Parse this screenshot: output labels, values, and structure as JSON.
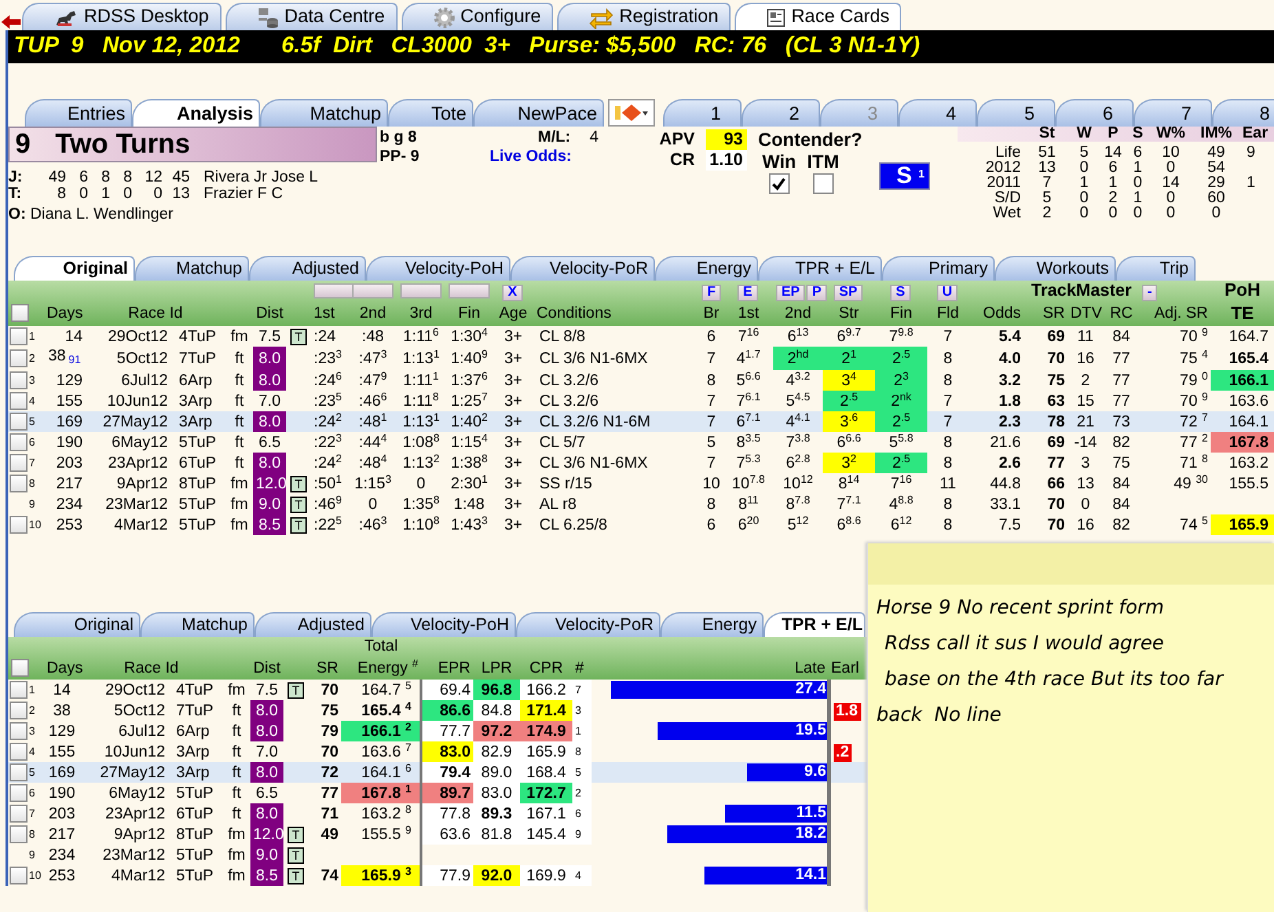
{
  "top_tabs": [
    {
      "label": "RDSS Desktop",
      "selected": false
    },
    {
      "label": "Data Centre",
      "selected": false
    },
    {
      "label": "Configure",
      "selected": false
    },
    {
      "label": "Registration",
      "selected": false
    },
    {
      "label": "Race Cards",
      "selected": true
    }
  ],
  "race_header": {
    "left": "TUP  9   Nov 12, 2012",
    "right": "6.5f  Dirt   CL3000  3+   Purse: $5,500   RC: 76   (CL 3 N1-1Y)"
  },
  "section_tabs": [
    {
      "label": "Entries",
      "selected": false
    },
    {
      "label": "Analysis",
      "selected": true
    },
    {
      "label": "Matchup",
      "selected": false
    },
    {
      "label": "Tote",
      "selected": false
    },
    {
      "label": "NewPace",
      "selected": false
    }
  ],
  "horse_tabs": [
    {
      "label": "1",
      "disabled": false
    },
    {
      "label": "2",
      "disabled": false
    },
    {
      "label": "3",
      "disabled": true
    },
    {
      "label": "4",
      "disabled": false
    },
    {
      "label": "5",
      "disabled": false
    },
    {
      "label": "6",
      "disabled": false
    },
    {
      "label": "7",
      "disabled": false
    },
    {
      "label": "8",
      "disabled": false
    }
  ],
  "horse": {
    "number": "9",
    "name": "Two Turns",
    "description": "b g 8",
    "post": "PP- 9",
    "ml_label": "M/L:",
    "ml_value": "4",
    "live_odds_label": "Live Odds:",
    "connections": [
      {
        "label": "J:",
        "stats": [
          "49",
          "6",
          "8",
          "8",
          "12",
          "45"
        ],
        "name": "Rivera Jr Jose L"
      },
      {
        "label": "T:",
        "stats": [
          "8",
          "0",
          "1",
          "0",
          "0",
          "13"
        ],
        "name": "Frazier F C"
      }
    ],
    "owner_label": "O:",
    "owner": "Diana L. Wendlinger",
    "apv_label": "APV",
    "apv": "93",
    "cr_label": "CR",
    "cr": "1.10",
    "contender": {
      "title": "Contender?",
      "options": [
        {
          "label": "Win",
          "checked": true
        },
        {
          "label": "ITM",
          "checked": false
        }
      ]
    },
    "speed_button": "S $^{1}$",
    "record": {
      "columns": [
        "St",
        "W",
        "P",
        "S",
        "W%",
        "IM%",
        "Ear"
      ],
      "rows": [
        {
          "label": "Life",
          "values": [
            "51",
            "5",
            "14",
            "6",
            "10",
            "49",
            "9"
          ]
        },
        {
          "label": "2012",
          "values": [
            "13",
            "0",
            "6",
            "1",
            "0",
            "54"
          ]
        },
        {
          "label": "2011",
          "values": [
            "7",
            "1",
            "1",
            "0",
            "14",
            "29",
            "1"
          ]
        },
        {
          "label": "S/D",
          "values": [
            "5",
            "0",
            "2",
            "1",
            "0",
            "60"
          ]
        },
        {
          "label": "Wet",
          "values": [
            "2",
            "0",
            "0",
            "0",
            "0",
            "0"
          ]
        }
      ]
    }
  },
  "upper_tabs": [
    {
      "label": "Original",
      "selected": true
    },
    {
      "label": "Matchup",
      "selected": false
    },
    {
      "label": "Adjusted",
      "selected": false
    },
    {
      "label": "Velocity-PoH",
      "selected": false
    },
    {
      "label": "Velocity-PoR",
      "selected": false
    },
    {
      "label": "Energy",
      "selected": false
    },
    {
      "label": "TPR + E/L",
      "selected": false
    },
    {
      "label": "Primary",
      "selected": false
    },
    {
      "label": "Workouts",
      "selected": false
    },
    {
      "label": "Trip",
      "selected": false
    }
  ],
  "upper_table": {
    "select_all_checked": false,
    "clear_button": "X",
    "pace_buttons": [
      "F",
      "E",
      "EP",
      "P",
      "SP",
      "S",
      "U"
    ],
    "trackmaster_label": "TrackMaster",
    "collapse_button": "-",
    "poh_label": "PoH",
    "columns": [
      "Days",
      "Race Id",
      "Dist",
      "1st",
      "2nd",
      "3rd",
      "Fin",
      "Age",
      "Conditions",
      "Br",
      "1st",
      "2nd",
      "Str",
      "Fin",
      "Fld",
      "Odds",
      "SR",
      "DTV",
      "RC",
      "Adj. SR",
      "TE"
    ],
    "rows": [
      {
        "n": "1",
        "checked": false,
        "selected": false,
        "days": "14",
        "date": "29Oct12",
        "race": "4TuP",
        "surf": "fm",
        "dist": "7.5",
        "turf": "T",
        "c1": ":24",
        "c2": ":48",
        "c3": "1:11$^{6}$",
        "fin": "1:30$^{4}$",
        "age": "3+",
        "cond": "CL 8/8",
        "br": "6",
        "p1": "7$^{16}$",
        "p2": "6$^{13}$",
        "str": "6$^{9.7}$",
        "pfin": "7$^{9.8}$",
        "fld": "7",
        "odds": {
          "text": "5.4",
          "bold": true
        },
        "sr": "69",
        "dtv": "11",
        "rc": "84",
        "adj": "70 $^{9}$",
        "te": "164.7"
      },
      {
        "n": "2",
        "checked": false,
        "selected": false,
        "days": "38",
        "days_note": "91",
        "date": "5Oct12",
        "race": "7TuP",
        "surf": "ft",
        "dist": {
          "text": "8.0",
          "color": "#800080"
        },
        "c1": ":23$^{3}$",
        "c2": ":47$^{3}$",
        "c3": "1:13$^{1}$",
        "fin": "1:40$^{9}$",
        "age": "3+",
        "cond": "CL 3/6 N1-6MX",
        "br": "7",
        "p1": "4$^{1.7}$",
        "p2": {
          "text": "2$^{hd}$",
          "color": "#2de680"
        },
        "str": {
          "text": "2$^{1}$",
          "color": "#2de680"
        },
        "pfin": {
          "text": "2$^{.5}$",
          "color": "#2de680"
        },
        "fld": "8",
        "odds": {
          "text": "4.0",
          "bold": true
        },
        "sr": "70",
        "dtv": "16",
        "rc": "77",
        "adj": "75 $^{4}$",
        "te": {
          "text": "165.4",
          "bold": true
        }
      },
      {
        "n": "3",
        "checked": false,
        "selected": false,
        "days": "129",
        "date": "6Jul12",
        "race": "6Arp",
        "surf": "ft",
        "dist": {
          "text": "8.0",
          "color": "#800080"
        },
        "c1": ":24$^{6}$",
        "c2": ":47$^{9}$",
        "c3": "1:11$^{1}$",
        "fin": "1:37$^{6}$",
        "age": "3+",
        "cond": "CL 3.2/6",
        "br": "8",
        "p1": "5$^{6.6}$",
        "p2": "4$^{3.2}$",
        "str": {
          "text": "3$^{4}$",
          "color": "#ffff00"
        },
        "pfin": {
          "text": "2$^{3}$",
          "color": "#2de680"
        },
        "fld": "8",
        "odds": {
          "text": "3.2",
          "bold": true
        },
        "sr": "75",
        "dtv": "2",
        "rc": "77",
        "adj": "79 $^{0}$",
        "te": {
          "text": "166.1",
          "color": "#2de680",
          "bold": true
        }
      },
      {
        "n": "4",
        "checked": false,
        "selected": false,
        "days": "155",
        "date": "10Jun12",
        "race": "3Arp",
        "surf": "ft",
        "dist": "7.0",
        "c1": ":23$^{5}$",
        "c2": ":46$^{6}$",
        "c3": "1:11$^{8}$",
        "fin": "1:25$^{7}$",
        "age": "3+",
        "cond": "CL 3.2/6",
        "br": "7",
        "p1": "7$^{6.1}$",
        "p2": "5$^{4.5}$",
        "str": {
          "text": "2$^{.5}$",
          "color": "#2de680"
        },
        "pfin": {
          "text": "2$^{nk}$",
          "color": "#2de680"
        },
        "fld": "7",
        "odds": {
          "text": "1.8",
          "bold": true
        },
        "sr": "63",
        "dtv": "15",
        "rc": "77",
        "adj": "70 $^{9}$",
        "te": "163.6"
      },
      {
        "n": "5",
        "checked": false,
        "selected": true,
        "days": "169",
        "date": "27May12",
        "race": "3Arp",
        "surf": "ft",
        "dist": {
          "text": "8.0",
          "color": "#800080"
        },
        "c1": ":24$^{2}$",
        "c2": ":48$^{1}$",
        "c3": "1:13$^{1}$",
        "fin": "1:40$^{2}$",
        "age": "3+",
        "cond": "CL 3.2/6 N1-6M",
        "br": "7",
        "p1": "6$^{7.1}$",
        "p2": "4$^{4.1}$",
        "str": {
          "text": "3$^{.6}$",
          "color": "#ffff00"
        },
        "pfin": {
          "text": "2$^{.5}$",
          "color": "#2de680"
        },
        "fld": "7",
        "odds": {
          "text": "2.3",
          "bold": true
        },
        "sr": "78",
        "dtv": "21",
        "rc": "73",
        "adj": "72 $^{7}$",
        "te": "164.1"
      },
      {
        "n": "6",
        "checked": false,
        "selected": false,
        "days": "190",
        "date": "6May12",
        "race": "5TuP",
        "surf": "ft",
        "dist": "6.5",
        "c1": ":22$^{3}$",
        "c2": ":44$^{4}$",
        "c3": "1:08$^{8}$",
        "fin": "1:15$^{4}$",
        "age": "3+",
        "cond": "CL 5/7",
        "br": "5",
        "p1": "8$^{3.5}$",
        "p2": "7$^{3.8}$",
        "str": "6$^{6.6}$",
        "pfin": "5$^{5.8}$",
        "fld": "8",
        "odds": "21.6",
        "sr": "69",
        "dtv": "-14",
        "rc": "82",
        "adj": "77 $^{2}$",
        "te": {
          "text": "167.8",
          "color": "#f08080",
          "bold": true
        }
      },
      {
        "n": "7",
        "checked": false,
        "selected": false,
        "days": "203",
        "date": "23Apr12",
        "race": "6TuP",
        "surf": "ft",
        "dist": {
          "text": "8.0",
          "color": "#800080"
        },
        "c1": ":24$^{2}$",
        "c2": ":48$^{4}$",
        "c3": "1:13$^{2}$",
        "fin": "1:38$^{8}$",
        "age": "3+",
        "cond": "CL 3/6 N1-6MX",
        "br": "7",
        "p1": "7$^{5.3}$",
        "p2": "6$^{2.8}$",
        "str": {
          "text": "3$^{2}$",
          "color": "#ffff00"
        },
        "pfin": {
          "text": "2$^{.5}$",
          "color": "#2de680"
        },
        "fld": "8",
        "odds": {
          "text": "2.6",
          "bold": true
        },
        "sr": "77",
        "dtv": "3",
        "rc": "75",
        "adj": "71 $^{8}$",
        "te": "163.2"
      },
      {
        "n": "8",
        "checked": false,
        "selected": false,
        "days": "217",
        "date": "9Apr12",
        "race": "8TuP",
        "surf": "fm",
        "dist": {
          "text": "12.0",
          "color": "#800080"
        },
        "turf": "T",
        "c1": ":50$^{1}$",
        "c2": "1:15$^{3}$",
        "c3": "0",
        "fin": "2:30$^{1}$",
        "age": "3+",
        "cond": "SS r/15",
        "br": "10",
        "p1": "10$^{7.8}$",
        "p2": "10$^{12}$",
        "str": "8$^{14}$",
        "pfin": "7$^{16}$",
        "fld": "11",
        "odds": "44.8",
        "sr": "66",
        "dtv": "13",
        "rc": "84",
        "adj": "49 $^{30}$",
        "te": "155.5"
      },
      {
        "n": "9",
        "selected": false,
        "days": "234",
        "date": "23Mar12",
        "race": "5TuP",
        "surf": "fm",
        "dist": {
          "text": "9.0",
          "color": "#800080"
        },
        "turf": "T",
        "c1": ":46$^{9}$",
        "c2": "0",
        "c3": "1:35$^{8}$",
        "fin": "1:48",
        "age": "3+",
        "cond": "AL r8",
        "br": "8",
        "p1": "8$^{11}$",
        "p2": "8$^{7.8}$",
        "str": "7$^{7.1}$",
        "pfin": "4$^{8.8}$",
        "fld": "8",
        "odds": "33.1",
        "sr": "70",
        "dtv": "0",
        "rc": "84"
      },
      {
        "n": "10",
        "checked": false,
        "selected": false,
        "days": "253",
        "date": "4Mar12",
        "race": "5TuP",
        "surf": "fm",
        "dist": {
          "text": "8.5",
          "color": "#800080"
        },
        "turf": "T",
        "c1": ":22$^{5}$",
        "c2": ":46$^{3}$",
        "c3": "1:10$^{8}$",
        "fin": "1:43$^{3}$",
        "age": "3+",
        "cond": "CL 6.25/8",
        "br": "6",
        "p1": "6$^{20}$",
        "p2": "5$^{12}$",
        "str": "6$^{8.6}$",
        "pfin": "6$^{12}$",
        "fld": "8",
        "odds": "7.5",
        "sr": "70",
        "dtv": "16",
        "rc": "82",
        "adj": "74 $^{5}$",
        "te": {
          "text": "165.9",
          "color": "#ffff00",
          "bold": true
        }
      }
    ]
  },
  "lower_tabs": [
    {
      "label": "Original",
      "selected": false
    },
    {
      "label": "Matchup",
      "selected": false
    },
    {
      "label": "Adjusted",
      "selected": false
    },
    {
      "label": "Velocity-PoH",
      "selected": false
    },
    {
      "label": "Velocity-PoR",
      "selected": false
    },
    {
      "label": "Energy",
      "selected": false
    },
    {
      "label": "TPR + E/L",
      "selected": true
    }
  ],
  "lower_table": {
    "select_all_checked": false,
    "total_label": "Total",
    "columns": [
      "Days",
      "Race Id",
      "Dist",
      "SR",
      "Energy $^{#}$",
      "EPR",
      "LPR",
      "CPR",
      "#",
      "Late",
      "Earl"
    ],
    "rows": [
      {
        "n": "1",
        "checked": false,
        "selected": false,
        "days": "14",
        "date": "29Oct12",
        "race": "4TuP",
        "surf": "fm",
        "dist": "7.5",
        "turf": "T",
        "sr": "70",
        "energy": "164.7 $^{5}$",
        "epr": "69.4",
        "lpr": {
          "text": "96.8",
          "color": "#2de680",
          "bold": true
        },
        "cpr": "166.2",
        "rank": "7",
        "late": {
          "text": "27.4",
          "level": 0.92
        }
      },
      {
        "n": "2",
        "checked": false,
        "selected": false,
        "days": "38",
        "date": "5Oct12",
        "race": "7TuP",
        "surf": "ft",
        "dist": {
          "text": "8.0",
          "color": "#800080"
        },
        "sr": "75",
        "energy": {
          "text": "165.4 $^{4}$",
          "bold": true
        },
        "epr": {
          "text": "86.6",
          "color": "#2de680",
          "bold": true
        },
        "lpr": "84.8",
        "cpr": {
          "text": "171.4",
          "color": "#ffff00",
          "bold": true
        },
        "rank": "3",
        "early": "1.8"
      },
      {
        "n": "3",
        "checked": false,
        "selected": false,
        "days": "129",
        "date": "6Jul12",
        "race": "6Arp",
        "surf": "ft",
        "dist": {
          "text": "8.0",
          "color": "#800080"
        },
        "sr": "79",
        "energy": {
          "text": "166.1 $^{2}$",
          "color": "#2de680",
          "bold": true
        },
        "epr": "77.7",
        "lpr": {
          "text": "97.2",
          "color": "#f08080",
          "bold": true
        },
        "cpr": {
          "text": "174.9",
          "color": "#f08080",
          "bold": true
        },
        "rank": "1",
        "late": {
          "text": "19.5",
          "level": 0.72
        }
      },
      {
        "n": "4",
        "checked": false,
        "selected": false,
        "days": "155",
        "date": "10Jun12",
        "race": "3Arp",
        "surf": "ft",
        "dist": "7.0",
        "sr": "70",
        "energy": "163.6 $^{7}$",
        "epr": {
          "text": "83.0",
          "color": "#ffff00",
          "bold": true
        },
        "lpr": "82.9",
        "cpr": "165.9",
        "rank": "8",
        "early": ".2"
      },
      {
        "n": "5",
        "checked": false,
        "selected": true,
        "days": "169",
        "date": "27May12",
        "race": "3Arp",
        "surf": "ft",
        "dist": {
          "text": "8.0",
          "color": "#800080"
        },
        "sr": "72",
        "energy": "164.1 $^{6}$",
        "epr": {
          "text": "79.4",
          "bold": true
        },
        "lpr": "89.0",
        "cpr": "168.4",
        "rank": "5",
        "late": {
          "text": "9.6",
          "level": 0.34
        }
      },
      {
        "n": "6",
        "checked": false,
        "selected": false,
        "days": "190",
        "date": "6May12",
        "race": "5TuP",
        "surf": "ft",
        "dist": "6.5",
        "sr": "77",
        "energy": {
          "text": "167.8 $^{1}$",
          "color": "#f08080",
          "bold": true
        },
        "epr": {
          "text": "89.7",
          "color": "#f08080",
          "bold": true
        },
        "lpr": "83.0",
        "cpr": {
          "text": "172.7",
          "color": "#2de680",
          "bold": true
        },
        "rank": "2"
      },
      {
        "n": "7",
        "checked": false,
        "selected": false,
        "days": "203",
        "date": "23Apr12",
        "race": "6TuP",
        "surf": "ft",
        "dist": {
          "text": "8.0",
          "color": "#800080"
        },
        "sr": "71",
        "energy": "163.2 $^{8}$",
        "epr": "77.8",
        "lpr": {
          "text": "89.3",
          "bold": true
        },
        "cpr": "167.1",
        "rank": "6",
        "late": {
          "text": "11.5",
          "level": 0.43
        }
      },
      {
        "n": "8",
        "checked": false,
        "selected": false,
        "days": "217",
        "date": "9Apr12",
        "race": "8TuP",
        "surf": "fm",
        "dist": {
          "text": "12.0",
          "color": "#800080"
        },
        "turf": "T",
        "sr": "49",
        "energy": "155.5 $^{9}$",
        "epr": "63.6",
        "lpr": "81.8",
        "cpr": "145.4",
        "rank": "9",
        "late": {
          "text": "18.2",
          "level": 0.68
        }
      },
      {
        "n": "9",
        "selected": false,
        "days": "234",
        "date": "23Mar12",
        "race": "5TuP",
        "surf": "fm",
        "dist": {
          "text": "9.0",
          "color": "#800080"
        },
        "turf": "T"
      },
      {
        "n": "10",
        "checked": false,
        "selected": false,
        "days": "253",
        "date": "4Mar12",
        "race": "5TuP",
        "surf": "fm",
        "dist": {
          "text": "8.5",
          "color": "#800080"
        },
        "turf": "T",
        "sr": "74",
        "energy": {
          "text": "165.9 $^{3}$",
          "color": "#ffff00",
          "bold": true
        },
        "epr": "77.9",
        "lpr": {
          "text": "92.0",
          "color": "#ffff00",
          "bold": true
        },
        "cpr": "169.9",
        "rank": "4",
        "late": {
          "text": "14.1",
          "level": 0.52
        }
      }
    ]
  },
  "sticky_note": {
    "lines": [
      "Horse 9 No recent sprint form",
      "Rdss call it sus I would agree",
      "base on the 4th race But its too far",
      "back  No line"
    ]
  }
}
